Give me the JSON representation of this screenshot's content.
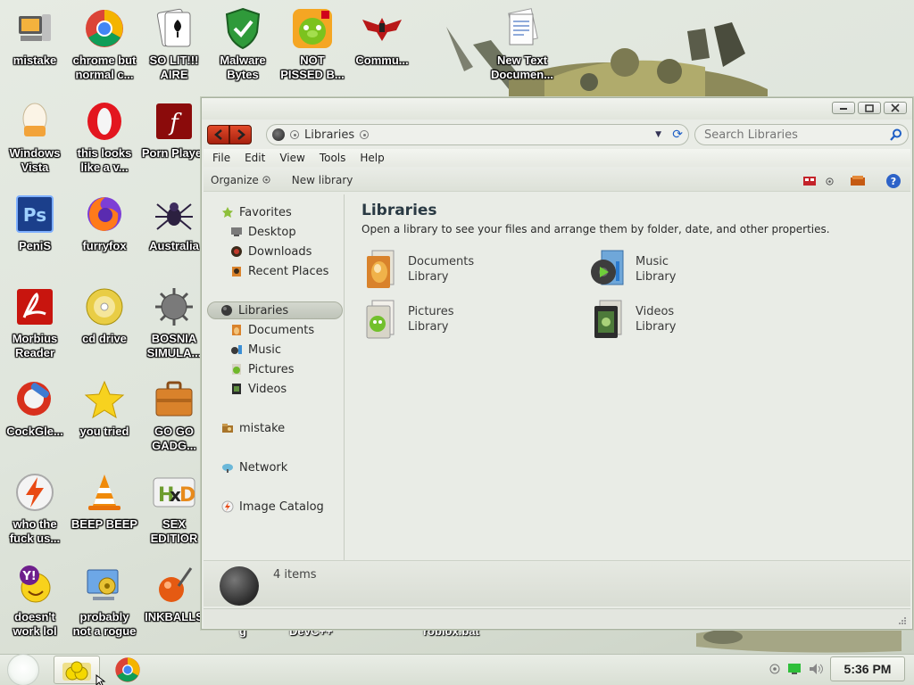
{
  "desktop": {
    "icons": [
      {
        "label": "mistake",
        "icon": "computer-icon"
      },
      {
        "label": "chrome but normal c...",
        "icon": "chrome-icon"
      },
      {
        "label": "SO LIT!!! AIRE",
        "icon": "solitaire-icon"
      },
      {
        "label": "Malware Bytes",
        "icon": "shield-icon"
      },
      {
        "label": "NOT PISSED B...",
        "icon": "angry-birds-pig-icon"
      },
      {
        "label": "Commu...",
        "icon": "eagle-icon"
      },
      {
        "label": "New Text Documen...",
        "icon": "text-document-icon"
      },
      {
        "label": "Windows Vista",
        "icon": "egg-icon"
      },
      {
        "label": "this looks like a v...",
        "icon": "opera-icon"
      },
      {
        "label": "Porn Player",
        "icon": "flash-icon"
      },
      {
        "label": "PeniS",
        "icon": "photoshop-icon"
      },
      {
        "label": "furryfox",
        "icon": "firefox-icon"
      },
      {
        "label": "Australia",
        "icon": "spider-icon"
      },
      {
        "label": "Morbius Reader",
        "icon": "pdf-reader-icon"
      },
      {
        "label": "cd drive",
        "icon": "cd-icon"
      },
      {
        "label": "BOSNIA SIMULA...",
        "icon": "naval-mine-icon"
      },
      {
        "label": "CockGle...",
        "icon": "ccleaner-icon"
      },
      {
        "label": "you tried",
        "icon": "star-icon"
      },
      {
        "label": "GO GO GADG...",
        "icon": "briefcase-icon"
      },
      {
        "label": "who the fuck us...",
        "icon": "lightning-icon"
      },
      {
        "label": "BEEP BEEP",
        "icon": "vlc-cone-icon"
      },
      {
        "label": "SEX EDITIOR",
        "icon": "hxd-icon"
      },
      {
        "label": "doesn't work lol",
        "icon": "yahoo-messenger-icon"
      },
      {
        "label": "probably not a rogue",
        "icon": "control-panel-icon"
      },
      {
        "label": "INKBALLS",
        "icon": "inkball-icon"
      }
    ],
    "hidden_labels": [
      "g",
      "DevC++",
      "roblox.bat"
    ]
  },
  "explorer": {
    "address": "Libraries",
    "search_placeholder": "Search Libraries",
    "menu": [
      "File",
      "Edit",
      "View",
      "Tools",
      "Help"
    ],
    "toolbar": {
      "organize": "Organize",
      "new_library": "New library"
    },
    "nav": {
      "favorites": "Favorites",
      "fav_items": [
        "Desktop",
        "Downloads",
        "Recent Places"
      ],
      "libraries": "Libraries",
      "lib_items": [
        "Documents",
        "Music",
        "Pictures",
        "Videos"
      ],
      "user": "mistake",
      "network": "Network",
      "image_catalog": "Image Catalog"
    },
    "content": {
      "title": "Libraries",
      "subtitle": "Open a library to see your files and arrange them by folder, date, and other properties.",
      "libraries": [
        {
          "name": "Documents",
          "type": "Library"
        },
        {
          "name": "Music",
          "type": "Library"
        },
        {
          "name": "Pictures",
          "type": "Library"
        },
        {
          "name": "Videos",
          "type": "Library"
        }
      ]
    },
    "details": {
      "count": "4 items"
    }
  },
  "taskbar": {
    "clock": "5:36 PM"
  },
  "colors": {
    "accent_red": "#c62b12",
    "link_blue": "#1e5fc6"
  }
}
